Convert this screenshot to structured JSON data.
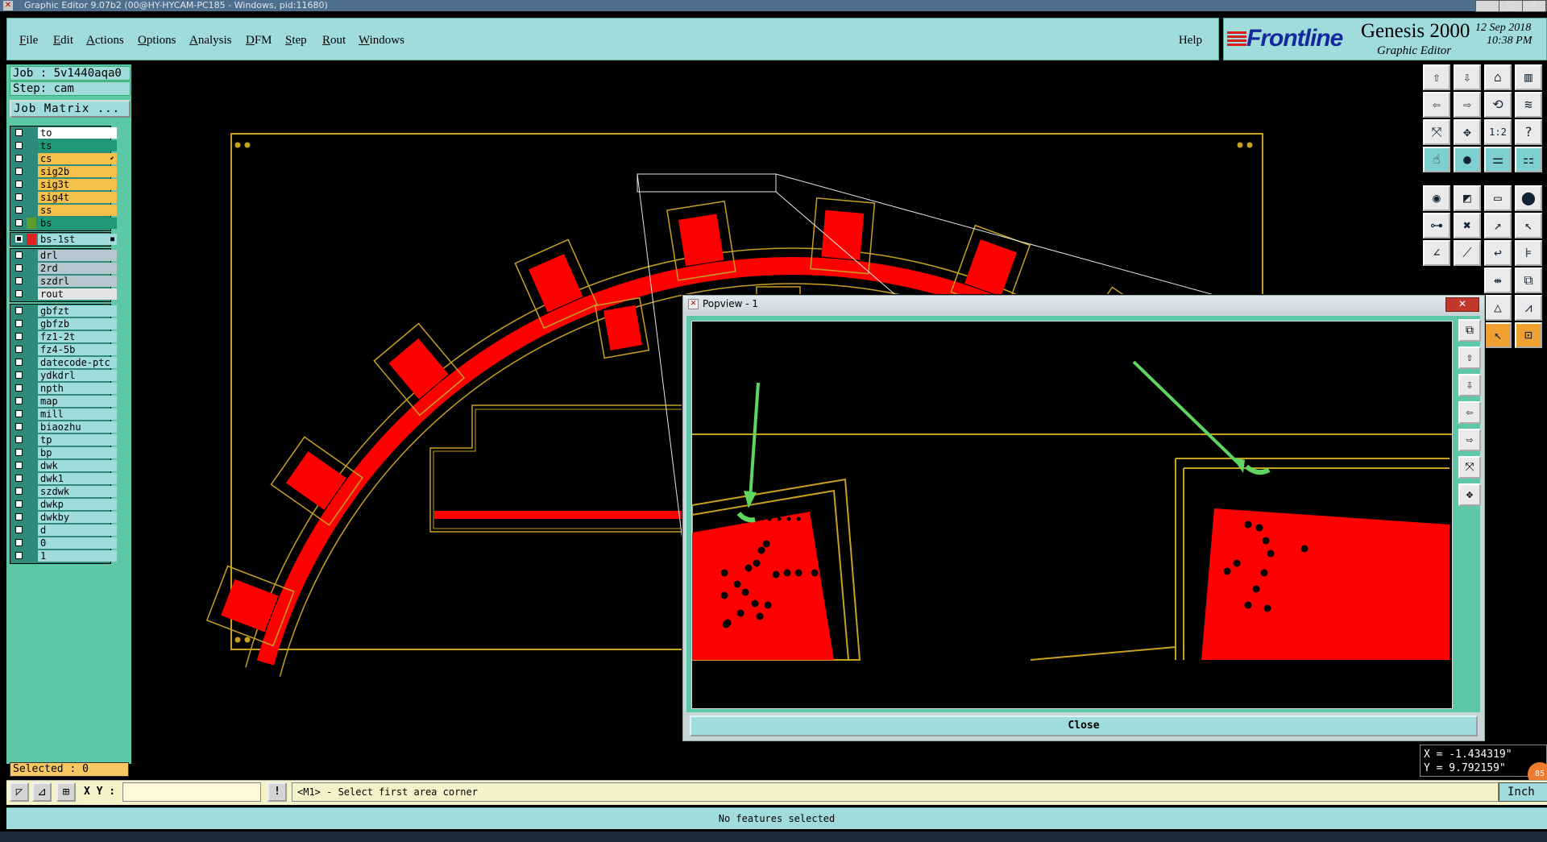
{
  "window": {
    "title": "Graphic Editor 9.07b2 (00@HY-HYCAM-PC185 - Windows, pid:11680)",
    "minimize_glyph": "–",
    "maximize_glyph": "□",
    "close_glyph": "✕"
  },
  "menu": {
    "items": [
      "File",
      "Edit",
      "Actions",
      "Options",
      "Analysis",
      "DFM",
      "Step",
      "Rout",
      "Windows"
    ],
    "help": "Help"
  },
  "brand": {
    "logo": "Frontline",
    "product": "Genesis 2000",
    "subtitle": "Graphic Editor",
    "date": "12 Sep 2018",
    "time": "10:38 PM"
  },
  "job": {
    "job_label": "Job : 5v1440aqa0",
    "step_label": "Step: cam",
    "matrix_button": "Job Matrix ..."
  },
  "layers": {
    "group1": [
      {
        "name": "to",
        "color": "#ffffff",
        "checked": false
      },
      {
        "name": "ts",
        "color": "#1f9a78",
        "checked": false
      },
      {
        "name": "cs",
        "color": "#f5c04a",
        "checked": false,
        "mark": "⬋"
      },
      {
        "name": "sig2b",
        "color": "#f5c04a",
        "checked": false
      },
      {
        "name": "sig3t",
        "color": "#f5c04a",
        "checked": false
      },
      {
        "name": "sig4t",
        "color": "#f5c04a",
        "checked": false
      },
      {
        "name": "ss",
        "color": "#f5c04a",
        "checked": false
      },
      {
        "name": "bs",
        "color": "#1f9a78",
        "checked": false,
        "swatch": "#5a9e2e"
      }
    ],
    "work_layer": {
      "name": "bs-1st",
      "color": "#a0dcdc",
      "checked": true,
      "swatch": "#e02020",
      "mark": "■"
    },
    "group2": [
      {
        "name": "drl",
        "color": "#b7c7d0"
      },
      {
        "name": "2rd",
        "color": "#b7c7d0"
      },
      {
        "name": "szdrl",
        "color": "#b7c7d0"
      },
      {
        "name": "rout",
        "color": "#e4e4e4"
      }
    ],
    "group3": [
      {
        "name": "gbfzt"
      },
      {
        "name": "gbfzb"
      },
      {
        "name": "fz1-2t"
      },
      {
        "name": "fz4-5b"
      },
      {
        "name": "datecode-ptc"
      },
      {
        "name": "ydkdrl"
      },
      {
        "name": "npth"
      },
      {
        "name": "map"
      },
      {
        "name": "mill"
      },
      {
        "name": "biaozhu"
      },
      {
        "name": "tp"
      },
      {
        "name": "bp"
      },
      {
        "name": "dwk"
      },
      {
        "name": "dwk1"
      },
      {
        "name": "szdwk"
      },
      {
        "name": "dwkp"
      },
      {
        "name": "dwkby"
      },
      {
        "name": "d"
      },
      {
        "name": "0"
      },
      {
        "name": "1"
      }
    ],
    "group3_color": "#a0dcdc"
  },
  "selected": "Selected : 0",
  "command_bar": {
    "xy_label": "X Y :",
    "xy_value": "",
    "bang": "!",
    "prompt": "<M1> - Select first area corner",
    "units": "Inch"
  },
  "status": "No features selected",
  "coords": {
    "x": "X = -1.434319\"",
    "y": "Y = 9.792159\""
  },
  "badge": "85",
  "popview": {
    "title": "Popview - 1",
    "close_label": "Close",
    "close_glyph": "✕"
  },
  "colors": {
    "copper": "#ff0000",
    "outline": "#c8a020",
    "marker": "#5fd65f"
  }
}
